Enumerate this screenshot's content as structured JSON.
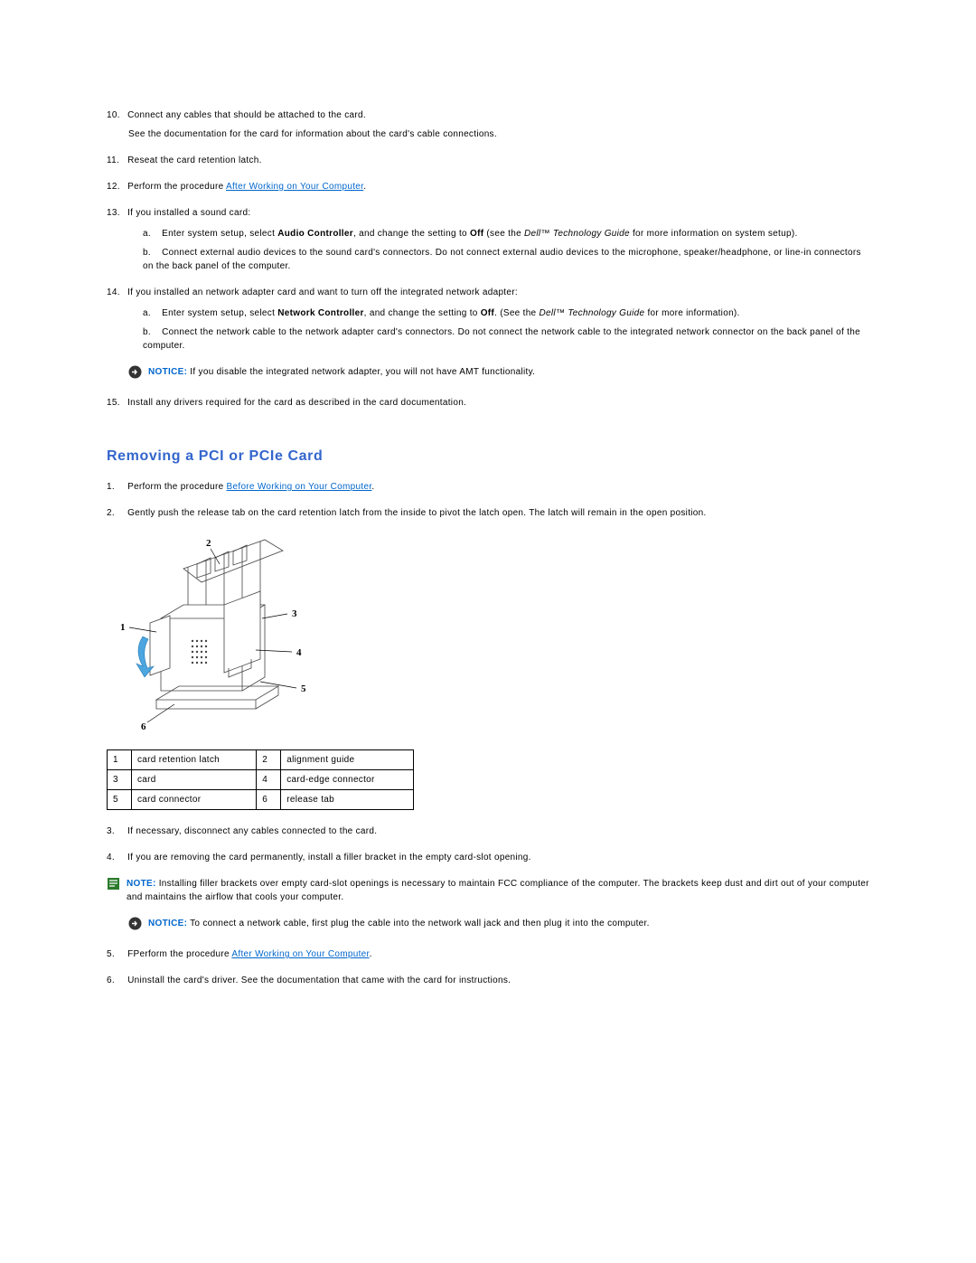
{
  "steps_a": {
    "s10": {
      "n": "10.",
      "text": "Connect any cables that should be attached to the card.",
      "sub": "See the documentation for the card for information about the card's cable connections."
    },
    "s11": {
      "n": "11.",
      "text": "Reseat the card retention latch."
    },
    "s12": {
      "n": "12.",
      "pre": "Perform the procedure ",
      "link": "After Working on Your Computer",
      "post": "."
    },
    "s13": {
      "n": "13.",
      "text": "If you installed a sound card:",
      "a": {
        "n": "a.",
        "pre": "Enter system setup, select ",
        "b1": "Audio Controller",
        "mid": ", and change the setting to ",
        "b2": "Off",
        "after": " (see the ",
        "it": "Dell™ Technology Guide",
        "post": " for more information on system setup)."
      },
      "b": {
        "n": "b.",
        "text": "Connect external audio devices to the sound card's connectors. Do not connect external audio devices to the microphone, speaker/headphone, or line-in connectors on the back panel of the computer."
      }
    },
    "s14": {
      "n": "14.",
      "text": "If you installed an network adapter card and want to turn off the integrated network adapter:",
      "a": {
        "n": "a.",
        "pre": "Enter system setup, select ",
        "b1": "Network Controller",
        "mid": ", and change the setting to ",
        "b2": "Off",
        "after": ". (See the ",
        "it": "Dell™ Technology Guide",
        "post": " for more information)."
      },
      "b": {
        "n": "b.",
        "text": "Connect the network cable to the network adapter card's connectors. Do not connect the network cable to the integrated network connector on the back panel of the computer."
      }
    },
    "notice1": {
      "label": "NOTICE:",
      "text": " If you disable the integrated network adapter, you will not have AMT functionality."
    },
    "s15": {
      "n": "15.",
      "text": "Install any drivers required for the card as described in the card documentation."
    }
  },
  "section_title": "Removing a PCI or PCIe Card",
  "steps_b": {
    "s1": {
      "n": "1.",
      "pre": "Perform the procedure ",
      "link": "Before Working on Your Computer",
      "post": "."
    },
    "s2": {
      "n": "2.",
      "text": "Gently push the release tab on the card retention latch from the inside to pivot the latch open. The latch will remain in the open position."
    },
    "s3": {
      "n": "3.",
      "text": "If necessary, disconnect any cables connected to the card."
    },
    "s4": {
      "n": "4.",
      "text": "If you are removing the card permanently, install a filler bracket in the empty card-slot opening.",
      "note": {
        "label": "NOTE:",
        "text": " Installing filler brackets over empty card-slot openings is necessary to maintain FCC compliance of the computer. The brackets keep dust and dirt out of your computer and maintains the airflow that cools your computer."
      }
    },
    "notice2": {
      "label": "NOTICE:",
      "text": " To connect a network cable, first plug the cable into the network wall jack and then plug it into the computer."
    },
    "s5": {
      "n": "5.",
      "pre": "FPerform the procedure ",
      "link": "After Working on Your Computer",
      "post": "."
    },
    "s6": {
      "n": "6.",
      "text": "Uninstall the card's driver. See the documentation that came with the card for instructions."
    }
  },
  "legend": {
    "r1c1n": "1",
    "r1c1": "card retention latch",
    "r1c2n": "2",
    "r1c2": "alignment guide",
    "r2c1n": "3",
    "r2c1": "card",
    "r2c2n": "4",
    "r2c2": "card-edge connector",
    "r3c1n": "5",
    "r3c1": "card connector",
    "r3c2n": "6",
    "r3c2": "release tab"
  },
  "callouts": {
    "c1": "1",
    "c2": "2",
    "c3": "3",
    "c4": "4",
    "c5": "5",
    "c6": "6"
  }
}
